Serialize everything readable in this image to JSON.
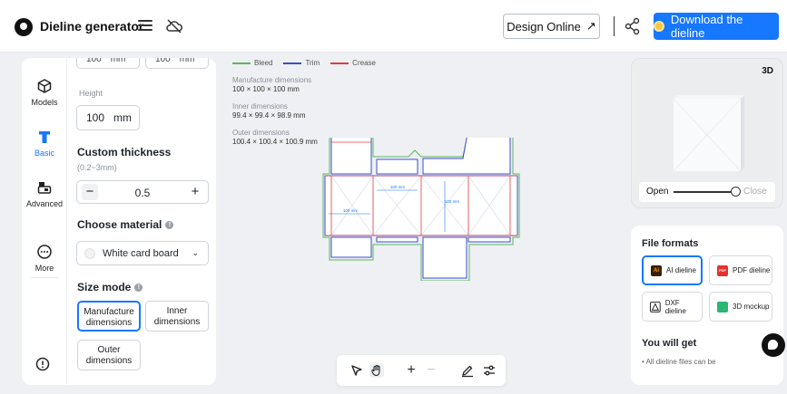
{
  "header": {
    "app_title": "Dieline generator",
    "design_online_label": "Design Online",
    "design_online_arrow": "↗",
    "download_label": "Download the dieline"
  },
  "sidebar": {
    "items": [
      {
        "label": "Models",
        "icon": "cube-icon"
      },
      {
        "label": "Basic",
        "icon": "text-t-icon"
      },
      {
        "label": "Advanced",
        "icon": "print-icon"
      },
      {
        "label": "More",
        "icon": "more-dots-icon"
      }
    ],
    "active": "Basic"
  },
  "settings": {
    "top_partial_values": [
      "100",
      "100"
    ],
    "top_partial_units": [
      "mm",
      "mm"
    ],
    "height_label": "Height",
    "height_value": "100",
    "height_unit": "mm",
    "thickness_title": "Custom thickness",
    "thickness_range": "(0.2~3mm)",
    "thickness_value": "0.5",
    "minus": "−",
    "plus": "+",
    "material_title": "Choose material",
    "material_value": "White card board",
    "size_mode_title": "Size mode",
    "size_modes": [
      "Manufacture dimensions",
      "Inner dimensions",
      "Outer dimensions"
    ],
    "active_size_mode": "Manufacture dimensions"
  },
  "canvas": {
    "legend": [
      {
        "label": "Bleed",
        "color": "#5cb85c"
      },
      {
        "label": "Trim",
        "color": "#3b4bd1"
      },
      {
        "label": "Crease",
        "color": "#e23b3b"
      }
    ],
    "dimensions": [
      {
        "label": "Manufacture dimensions",
        "value": "100 × 100 × 100 mm"
      },
      {
        "label": "Inner dimensions",
        "value": "99.4 × 99.4 × 98.9 mm"
      },
      {
        "label": "Outer dimensions",
        "value": "100.4 × 100.4 × 100.9 mm"
      }
    ],
    "dieline_labels": [
      "100 mm",
      "100 mm",
      "100 mm"
    ]
  },
  "toolbar": {
    "tools": [
      "select-arrow-icon",
      "hand-icon",
      "zoom-in-icon",
      "zoom-out-icon",
      "pen-icon",
      "sliders-icon"
    ]
  },
  "preview": {
    "badge": "3D",
    "open_label": "Open",
    "close_label": "Close",
    "open_amount": 1.0
  },
  "file_formats": {
    "title": "File formats",
    "options": [
      {
        "label": "AI dieline",
        "icon_text": "Ai",
        "color": "#3a1f07"
      },
      {
        "label": "PDF dieline",
        "icon_text": "PDF",
        "color": "#e5322d"
      },
      {
        "label": "DXF dieline",
        "icon_text": "",
        "color": "#222222"
      },
      {
        "label": "3D mockup",
        "icon_text": "",
        "color": "#2bb673"
      }
    ],
    "active": "AI dieline",
    "get_title": "You will get",
    "get_items": [
      "All dieline files can be"
    ]
  },
  "colors": {
    "accent": "#1677ff",
    "bleed": "#5cb85c",
    "trim": "#3b4bd1",
    "crease": "#e23b3b"
  }
}
